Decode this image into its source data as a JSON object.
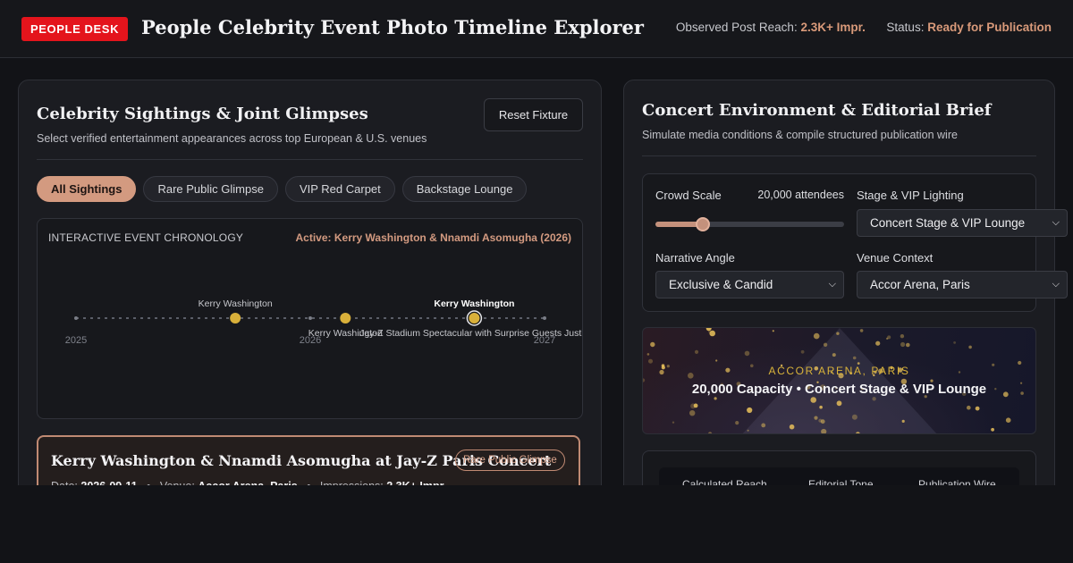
{
  "header": {
    "brand": "PEOPLE DESK",
    "title": "People Celebrity Event Photo Timeline Explorer",
    "reach_label": "Observed Post Reach:",
    "reach_value": "2.3K+ Impr.",
    "status_label": "Status:",
    "status_value": "Ready for Publication"
  },
  "sightings": {
    "title": "Celebrity Sightings & Joint Glimpses",
    "subtitle": "Select verified entertainment appearances across top European & U.S. venues",
    "reset_label": "Reset Fixture",
    "filters": [
      {
        "label": "All Sightings",
        "active": true
      },
      {
        "label": "Rare Public Glimpse",
        "active": false
      },
      {
        "label": "VIP Red Carpet",
        "active": false
      },
      {
        "label": "Backstage Lounge",
        "active": false
      }
    ],
    "timeline": {
      "heading": "INTERACTIVE EVENT CHRONOLOGY",
      "active_label": "Active: Kerry Washington & Nnamdi Asomugha (2026)",
      "year_ticks": [
        "2025",
        "2026",
        "2027"
      ],
      "events": [
        {
          "t": 0.68,
          "label": "Kerry Washington",
          "label_pos": "above",
          "active": false
        },
        {
          "t": 1.15,
          "label": "Kerry Washington",
          "label_pos": "below",
          "active": false
        },
        {
          "t": 1.7,
          "label": "Kerry Washington",
          "label_pos": "above",
          "active": true,
          "caption": "Jay-Z Stadium Spectacular with Surprise Guests Justin"
        }
      ]
    },
    "selected_event": {
      "title": "Kerry Washington & Nnamdi Asomugha at Jay-Z Paris Concert",
      "badge": "Rare Public Glimpse",
      "date_label": "Date:",
      "date_value": "2026-09-11",
      "venue_label": "Venue:",
      "venue_value": "Accor Arena, Paris",
      "impressions_label": "Impressions:",
      "impressions_value": "2.3K+ Impr."
    }
  },
  "brief": {
    "title": "Concert Environment & Editorial Brief",
    "subtitle": "Simulate media conditions & compile structured publication wire",
    "crowd_label": "Crowd Scale",
    "crowd_value": "20,000 attendees",
    "crowd_fraction": 0.25,
    "lighting_label": "Stage & VIP Lighting",
    "lighting_value": "Concert Stage & VIP Lounge",
    "angle_label": "Narrative Angle",
    "angle_value": "Exclusive & Candid",
    "venue_label": "Venue Context",
    "venue_value": "Accor Arena, Paris",
    "venue_card": {
      "city": "ACCOR ARENA, PARIS",
      "capacity": "20,000 Capacity • Concert Stage & VIP Lounge"
    },
    "summary_columns": [
      "Calculated Reach",
      "Editorial Tone",
      "Publication Wire"
    ]
  },
  "colors": {
    "accent": "#d39a80",
    "brand_red": "#e4141c",
    "event_dot": "#d9b03a",
    "background": "#121317"
  }
}
